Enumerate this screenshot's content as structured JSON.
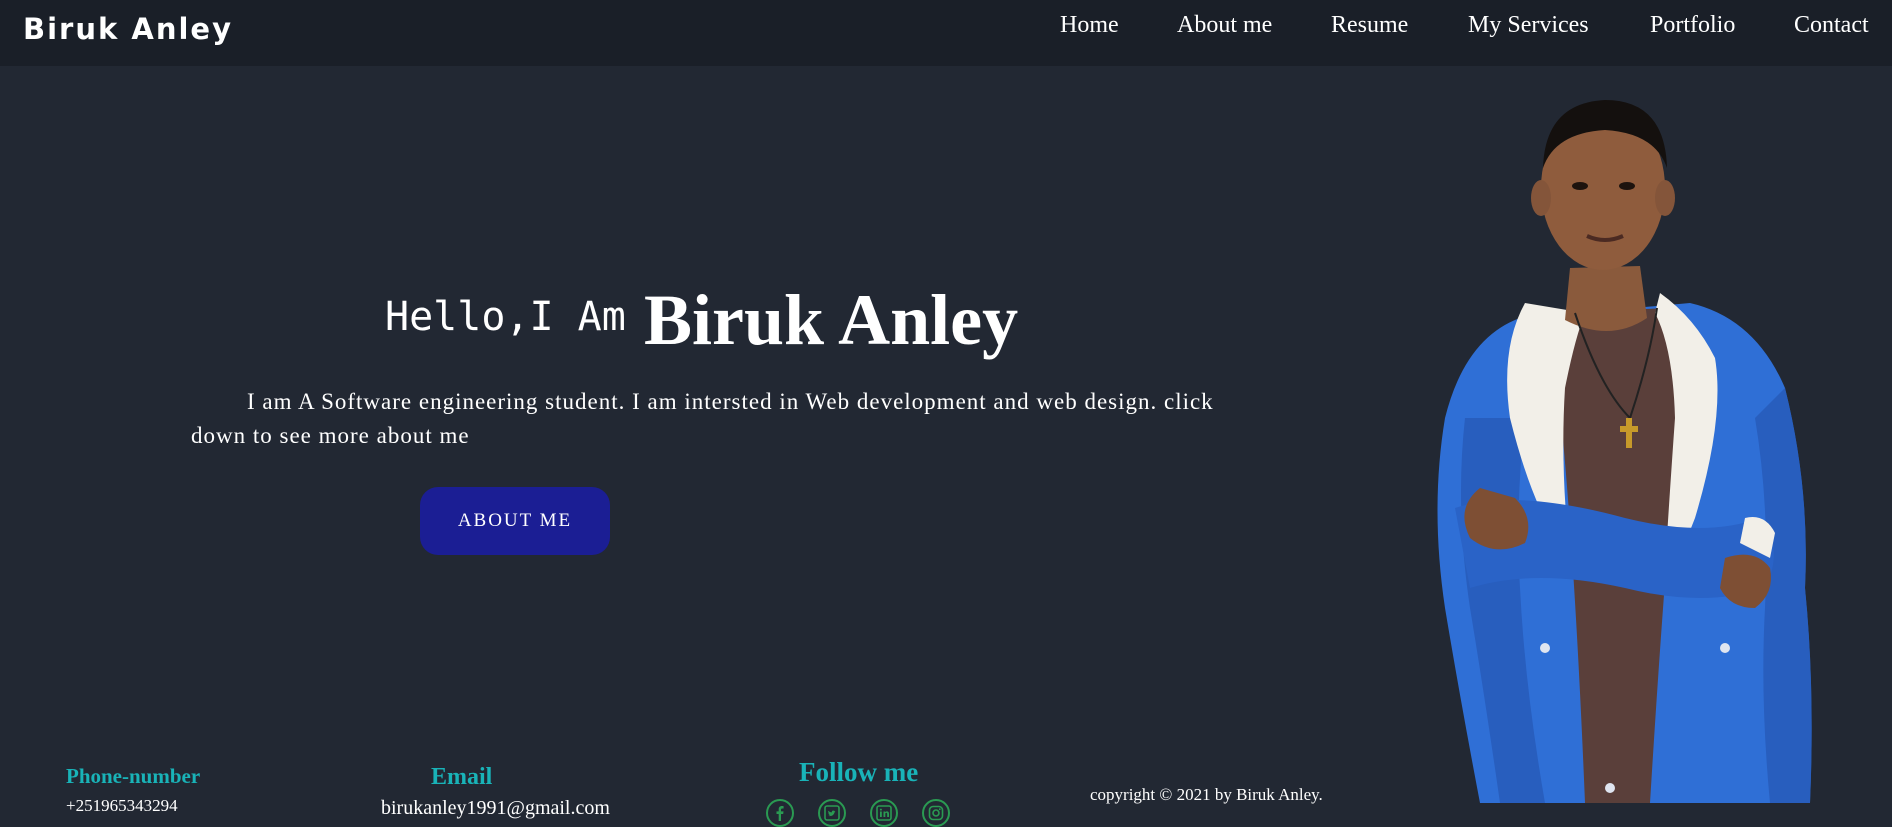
{
  "brand": "Biruk Anley",
  "nav": {
    "items": [
      {
        "label": "Home"
      },
      {
        "label": "About me"
      },
      {
        "label": "Resume"
      },
      {
        "label": "My Services"
      },
      {
        "label": "Portfolio"
      },
      {
        "label": "Contact"
      }
    ]
  },
  "hero": {
    "greeting": "Hello,I Am",
    "name": "Biruk Anley",
    "description": "I am A Software engineering student. I am intersted in Web development and web design. click down to see more about me",
    "button_label": "ABOUT ME"
  },
  "footer": {
    "phone_heading": "Phone-number",
    "phone_value": "+251965343294",
    "email_heading": "Email",
    "email_value": "birukanley1991@gmail.com",
    "follow_heading": "Follow me",
    "social_icons": [
      "facebook-icon",
      "twitter-icon",
      "linkedin-icon",
      "instagram-icon"
    ],
    "copyright": "copyright © 2021 by Biruk Anley."
  },
  "colors": {
    "background": "#222833",
    "navbar": "#1a1f28",
    "accent": "#19b3b8",
    "button": "#1b1e94",
    "social": "#2a9a52"
  }
}
